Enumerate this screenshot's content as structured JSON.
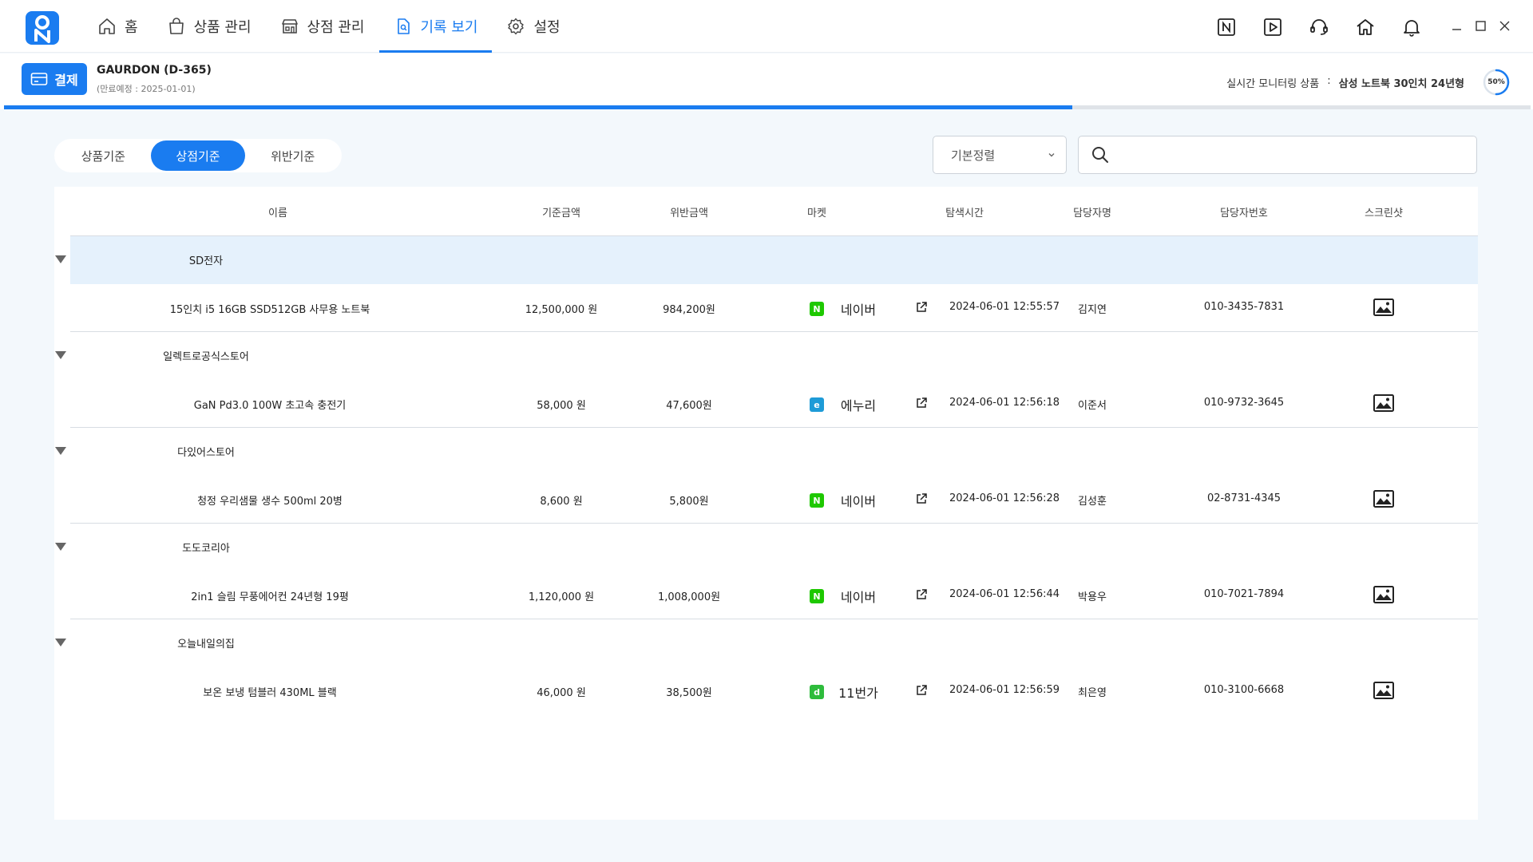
{
  "nav": {
    "items": [
      {
        "label": "홈",
        "icon": "home-outline-icon",
        "active": false
      },
      {
        "label": "상품 관리",
        "icon": "shopping-bag-icon",
        "active": false
      },
      {
        "label": "상점 관리",
        "icon": "store-icon",
        "active": false
      },
      {
        "label": "기록 보기",
        "icon": "document-search-icon",
        "active": true
      },
      {
        "label": "설정",
        "icon": "gear-icon",
        "active": false
      }
    ],
    "tools": [
      "n-box-icon",
      "play-box-icon",
      "headset-icon",
      "home-icon",
      "bell-icon"
    ]
  },
  "subheader": {
    "pay_label": "결제",
    "plan_name": "GAURDON (D-365)",
    "plan_expiry": "(만료예정 : 2025-01-01)",
    "monitor_label": "실시간 모니터링 상품",
    "monitor_sep": ":",
    "monitor_product": "삼성 노트북 30인치 24년형",
    "progress_label": "50%",
    "progress_value": 0.5,
    "loadbar_value": 0.7
  },
  "tabs": [
    {
      "label": "상품기준",
      "active": false
    },
    {
      "label": "상점기준",
      "active": true
    },
    {
      "label": "위반기준",
      "active": false
    }
  ],
  "sort": {
    "selected": "기본정렬"
  },
  "search": {
    "placeholder": "",
    "value": ""
  },
  "table": {
    "headers": {
      "name": "이름",
      "base_price": "기준금액",
      "violation_price": "위반금액",
      "market": "마켓",
      "scan_time": "탐색시간",
      "manager": "담당자명",
      "phone": "담당자번호",
      "screenshot": "스크린샷"
    },
    "groups": [
      {
        "shop": "SD전자",
        "selected": true,
        "row": {
          "product": "15인치 i5 16GB SSD512GB 사무용 노트북",
          "base_price": "12,500,000 원",
          "violation_price": "984,200원",
          "market_badge": "N",
          "market_color": "#1ec800",
          "market": "네이버",
          "scan_time": "2024-06-01 12:55:57",
          "manager": "김지연",
          "phone": "010-3435-7831"
        }
      },
      {
        "shop": "일렉트로공식스토어",
        "selected": false,
        "row": {
          "product": "GaN Pd3.0 100W 초고속 충전기",
          "base_price": "58,000 원",
          "violation_price": "47,600원",
          "market_badge": "e",
          "market_color": "#1e9bd7",
          "market": "에누리",
          "scan_time": "2024-06-01 12:56:18",
          "manager": "이준서",
          "phone": "010-9732-3645"
        }
      },
      {
        "shop": "다있어스토어",
        "selected": false,
        "row": {
          "product": "청정 우리샘물 생수 500ml 20병",
          "base_price": "8,600 원",
          "violation_price": "5,800원",
          "market_badge": "N",
          "market_color": "#1ec800",
          "market": "네이버",
          "scan_time": "2024-06-01 12:56:28",
          "manager": "김성훈",
          "phone": "02-8731-4345"
        }
      },
      {
        "shop": "도도코리아",
        "selected": false,
        "row": {
          "product": "2in1 슬림 무풍에어컨 24년형 19평",
          "base_price": "1,120,000 원",
          "violation_price": "1,008,000원",
          "market_badge": "N",
          "market_color": "#1ec800",
          "market": "네이버",
          "scan_time": "2024-06-01 12:56:44",
          "manager": "박용우",
          "phone": "010-7021-7894"
        }
      },
      {
        "shop": "오늘내일의집",
        "selected": false,
        "row": {
          "product": "보온 보냉 텀블러 430ML 블랙",
          "base_price": "46,000 원",
          "violation_price": "38,500원",
          "market_badge": "d",
          "market_color": "#2ebc3c",
          "market": "11번가",
          "scan_time": "2024-06-01 12:56:59",
          "manager": "최은영",
          "phone": "010-3100-6668"
        }
      }
    ]
  }
}
